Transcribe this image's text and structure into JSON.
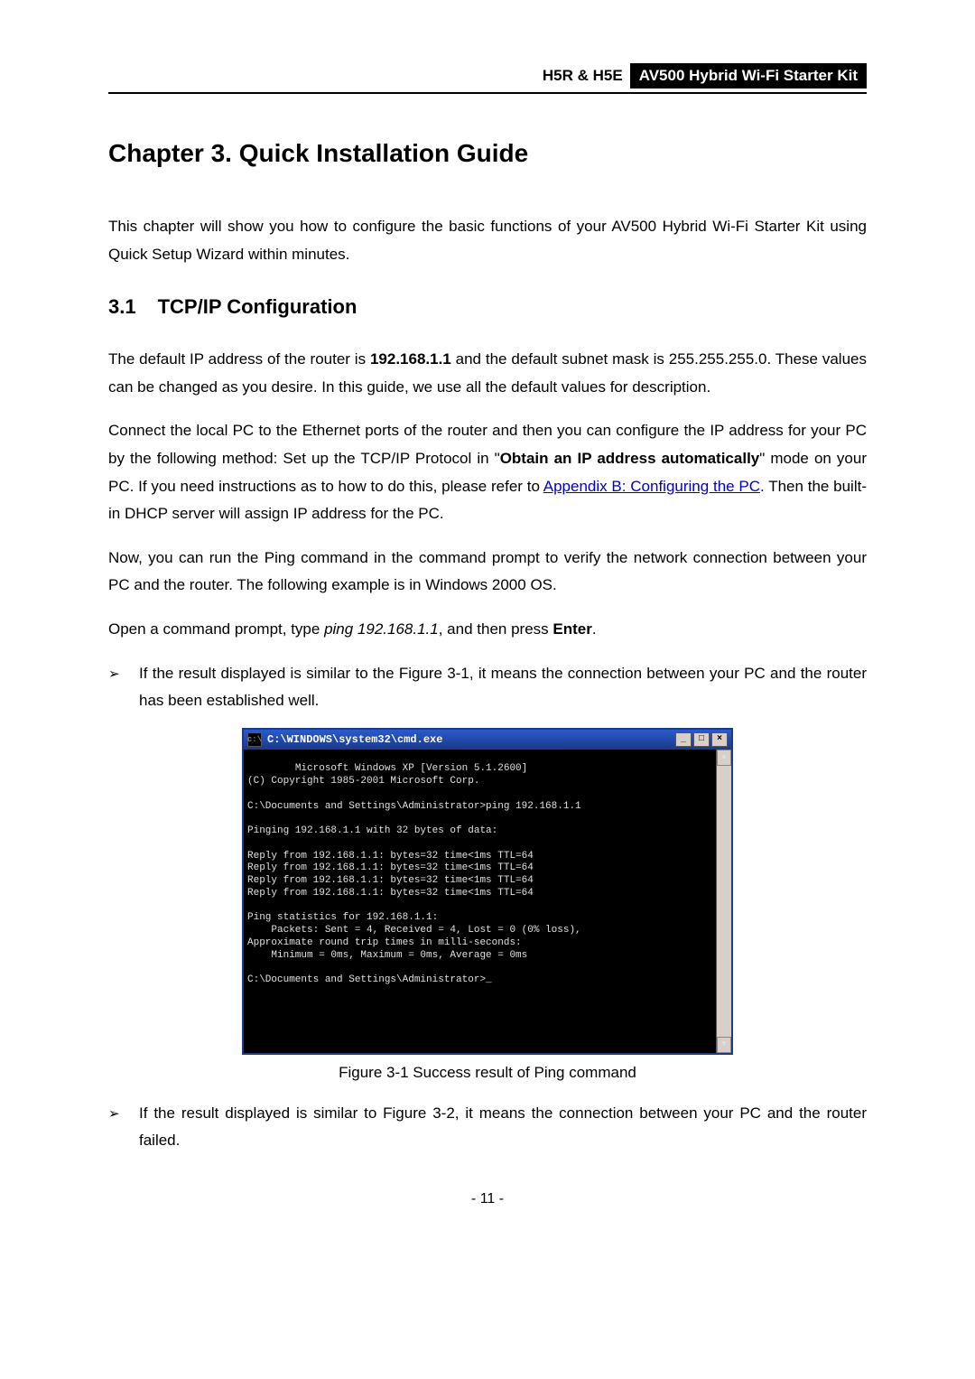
{
  "header": {
    "model": "H5R & H5E",
    "product": "AV500 Hybrid Wi-Fi Starter Kit"
  },
  "chapter": {
    "title": "Chapter 3.  Quick Installation Guide",
    "intro": "This chapter will show you how to configure the basic functions of your AV500 Hybrid Wi-Fi Starter Kit using Quick Setup Wizard within minutes."
  },
  "section31": {
    "number": "3.1",
    "title": "TCP/IP Configuration",
    "p1_a": "The default IP address of the router is ",
    "p1_ip": "192.168.1.1",
    "p1_b": " and the default subnet mask is 255.255.255.0. These values can be changed as you desire. In this guide, we use all the default values for description.",
    "p2_a": "Connect the local PC to the Ethernet ports of the router and then you can configure the IP address for your PC by the following method: Set up the TCP/IP Protocol in \"",
    "p2_bold": "Obtain an IP address automatically",
    "p2_b": "\" mode on your PC. If you need instructions as to how to do this, please refer to ",
    "p2_link": "Appendix B: Configuring the PC",
    "p2_c": ". Then the built-in DHCP server will assign IP address for the PC.",
    "p3": "Now, you can run the Ping command in the command prompt to verify the network connection between your PC and the router. The following example is in Windows 2000 OS.",
    "p4_a": "Open a command prompt, type ",
    "p4_cmd": "ping 192.168.1.1",
    "p4_b": ", and then press ",
    "p4_enter": "Enter",
    "p4_c": ".",
    "bullet1": "If the result displayed is similar to the Figure 3-1, it means the connection between your PC and the router has been established well.",
    "bullet2": "If the result displayed is similar to Figure 3-2, it means the connection between your PC and the router failed."
  },
  "cmd": {
    "title": "C:\\WINDOWS\\system32\\cmd.exe",
    "min": "_",
    "max": "□",
    "close": "×",
    "up": "▲",
    "down": "▼",
    "icon": "c:\\",
    "body": "Microsoft Windows XP [Version 5.1.2600]\n(C) Copyright 1985-2001 Microsoft Corp.\n\nC:\\Documents and Settings\\Administrator>ping 192.168.1.1\n\nPinging 192.168.1.1 with 32 bytes of data:\n\nReply from 192.168.1.1: bytes=32 time<1ms TTL=64\nReply from 192.168.1.1: bytes=32 time<1ms TTL=64\nReply from 192.168.1.1: bytes=32 time<1ms TTL=64\nReply from 192.168.1.1: bytes=32 time<1ms TTL=64\n\nPing statistics for 192.168.1.1:\n    Packets: Sent = 4, Received = 4, Lost = 0 (0% loss),\nApproximate round trip times in milli-seconds:\n    Minimum = 0ms, Maximum = 0ms, Average = 0ms\n\nC:\\Documents and Settings\\Administrator>_"
  },
  "figure_caption": "Figure 3-1 Success result of Ping command",
  "page_number": "- 11 -",
  "bullet_glyph": "➢"
}
